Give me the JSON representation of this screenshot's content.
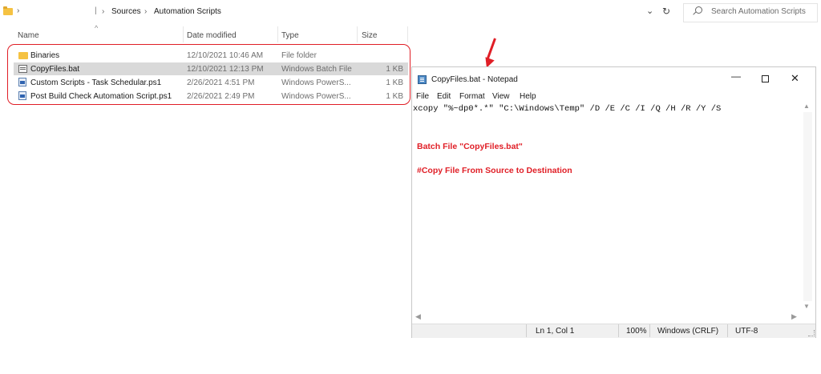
{
  "explorer": {
    "breadcrumb": [
      "Sources",
      "Automation Scripts"
    ],
    "search_placeholder": "Search Automation Scripts",
    "columns": {
      "name": "Name",
      "date": "Date modified",
      "type": "Type",
      "size": "Size"
    },
    "files": [
      {
        "name": "Binaries",
        "date": "12/10/2021 10:46 AM",
        "type": "File folder",
        "size": "",
        "icon": "folder-icon"
      },
      {
        "name": "CopyFiles.bat",
        "date": "12/10/2021 12:13 PM",
        "type": "Windows Batch File",
        "size": "1 KB",
        "icon": "batch-file-icon"
      },
      {
        "name": "Custom Scripts - Task Schedular.ps1",
        "date": "2/26/2021 4:51 PM",
        "type": "Windows PowerS...",
        "size": "1 KB",
        "icon": "powershell-file-icon"
      },
      {
        "name": "Post Build Check Automation Script.ps1",
        "date": "2/26/2021 2:49 PM",
        "type": "Windows PowerS...",
        "size": "1 KB",
        "icon": "powershell-file-icon"
      }
    ],
    "selected_index": 1,
    "highlight_color": "#e01e26"
  },
  "notepad": {
    "title": "CopyFiles.bat - Notepad",
    "menu": [
      "File",
      "Edit",
      "Format",
      "View",
      "Help"
    ],
    "content_line": "xcopy \"%~dp0*.*\" \"C:\\Windows\\Temp\" /D /E /C /I /Q /H /R /Y /S",
    "annotations": [
      "Batch File \"CopyFiles.bat\"",
      "#Copy File From Source to Destination"
    ],
    "status": {
      "position": "Ln 1, Col 1",
      "zoom": "100%",
      "line_ending": "Windows (CRLF)",
      "encoding": "UTF-8"
    }
  }
}
